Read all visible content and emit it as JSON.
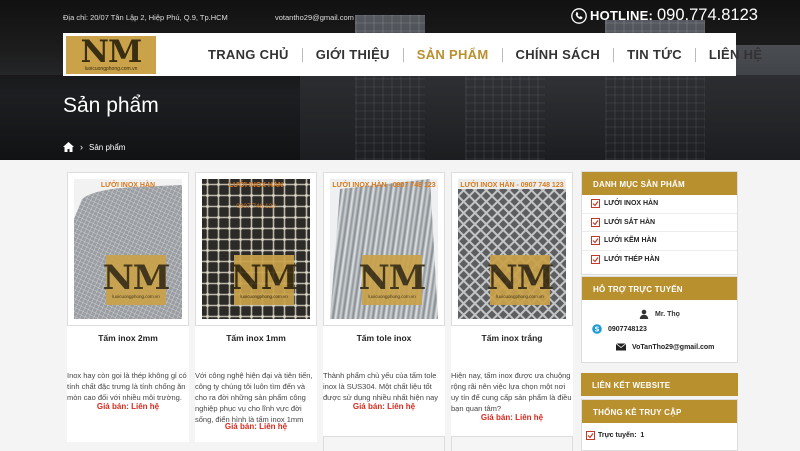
{
  "topbar": {
    "address": "Địa chỉ: 20/07 Tân Lập 2, Hiệp Phú,  Q.9, Tp.HCM",
    "email": "votantho29@gmail.com",
    "hotline_label": "HOTLINE:",
    "hotline_number": "090.774.8123"
  },
  "logo": {
    "letters": "NM",
    "domain": "luoicuongphong.com.vn"
  },
  "menu": [
    {
      "label": "TRANG CHỦ"
    },
    {
      "label": "GIỚI THIỆU"
    },
    {
      "label": "SẢN PHẨM"
    },
    {
      "label": "CHÍNH SÁCH"
    },
    {
      "label": "TIN TỨC"
    },
    {
      "label": "LIÊN HỆ"
    }
  ],
  "active_menu": "SẢN PHẨM",
  "page_title": "Sản phẩm",
  "breadcrumb": {
    "current": "Sản phẩm"
  },
  "products": [
    {
      "name": "Tấm inox 2mm",
      "watermark": "LƯỚI INOX HÀN",
      "watermark2": "",
      "desc": "Inox hay còn gọi là thép không gỉ có tính chất đặc trưng là tính chống ăn mòn cao đối với nhiều môi trường.",
      "price_label": "Giá bán:",
      "price_value": "Liên hệ"
    },
    {
      "name": "Tấm inox 1mm",
      "watermark": "LƯỚI INOX HÀN",
      "watermark2": "0907 748 123",
      "desc": "Với công nghệ hiện đại và tiên tiến, công ty chúng tôi luôn tìm đến và cho ra đời những sản phẩm công nghiệp phục vụ cho lĩnh vực đời sống, điển hình là tấm inox 1mm",
      "price_label": "Giá bán:",
      "price_value": "Liên hệ"
    },
    {
      "name": "Tấm tole inox",
      "watermark": "LƯỚI INOX HÀN - 0907 748 123",
      "watermark2": "",
      "desc": "Thành phẩm chủ yếu của tấm tole inox là SUS304. Một chất liệu tốt được sử dụng nhiều nhất hiện nay",
      "price_label": "Giá bán:",
      "price_value": "Liên hệ"
    },
    {
      "name": "Tấm inox trắng",
      "watermark": "LƯỚI INOX HÀN - 0907 748 123",
      "watermark2": "",
      "desc": "Hiện nay, tấm inox được ưa chuộng rộng rãi nên việc lựa chọn một nơi uy tín để cung cấp sản phẩm là điều bạn quan tâm?",
      "price_label": "Giá bán:",
      "price_value": "Liên hệ"
    }
  ],
  "sidebar": {
    "categories_title": "DANH MỤC SẢN PHẨM",
    "categories": [
      "LƯỚI INOX HÀN",
      "LƯỚI SẮT HÀN",
      "LƯỚI KẼM HÀN",
      "LƯỚI THÉP HÀN"
    ],
    "support_title": "HỖ TRỢ TRỰC TUYẾN",
    "support_name": "Mr. Thọ",
    "support_phone": "0907748123",
    "support_email": "VoTanTho29@gmail.com",
    "links_title": "LIÊN KẾT WEBSITE",
    "stats_title": "THỐNG KÊ TRUY CẬP",
    "stats_online_label": "Trực tuyến:",
    "stats_online_value": "1"
  },
  "colors": {
    "accent": "#b9902e",
    "price": "#d6281d",
    "logo_bg": "#c9a24a"
  }
}
